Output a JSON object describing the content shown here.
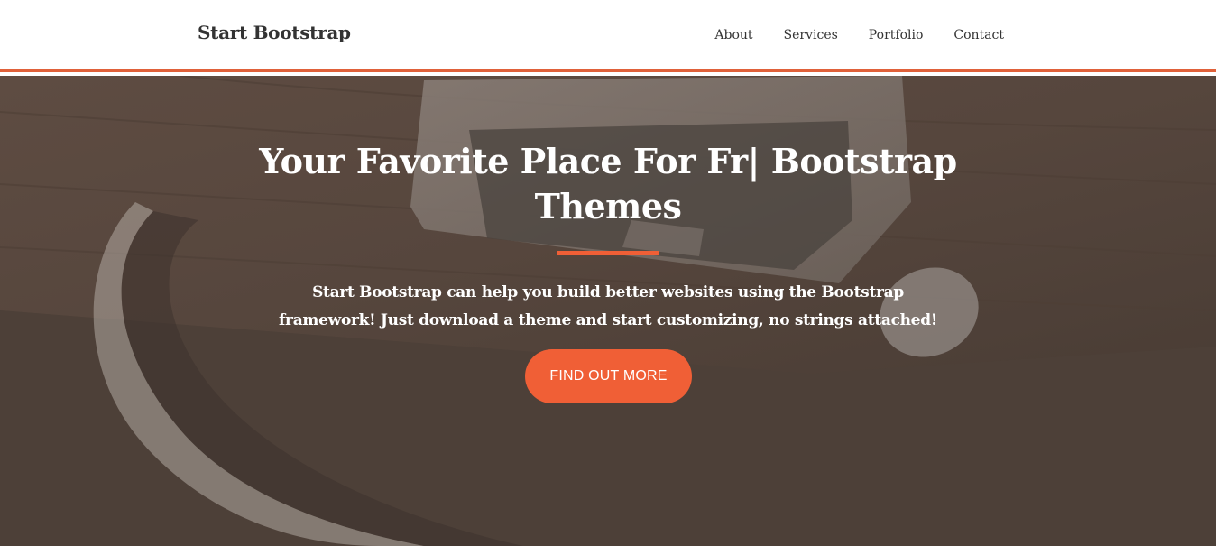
{
  "navbar": {
    "brand": "Start Bootstrap",
    "links": [
      "About",
      "Services",
      "Portfolio",
      "Contact"
    ]
  },
  "hero": {
    "title": "Your Favorite Place For Fr| Bootstrap Themes",
    "subtitle": "Start Bootstrap can help you build better websites using the Bootstrap framework! Just download a theme and start customizing, no strings attached!",
    "cta_label": "FIND OUT MORE"
  },
  "colors": {
    "accent": "#f05f36",
    "overlay": "#4f423a",
    "nav_text": "#333333",
    "text_light": "#ffffff"
  }
}
